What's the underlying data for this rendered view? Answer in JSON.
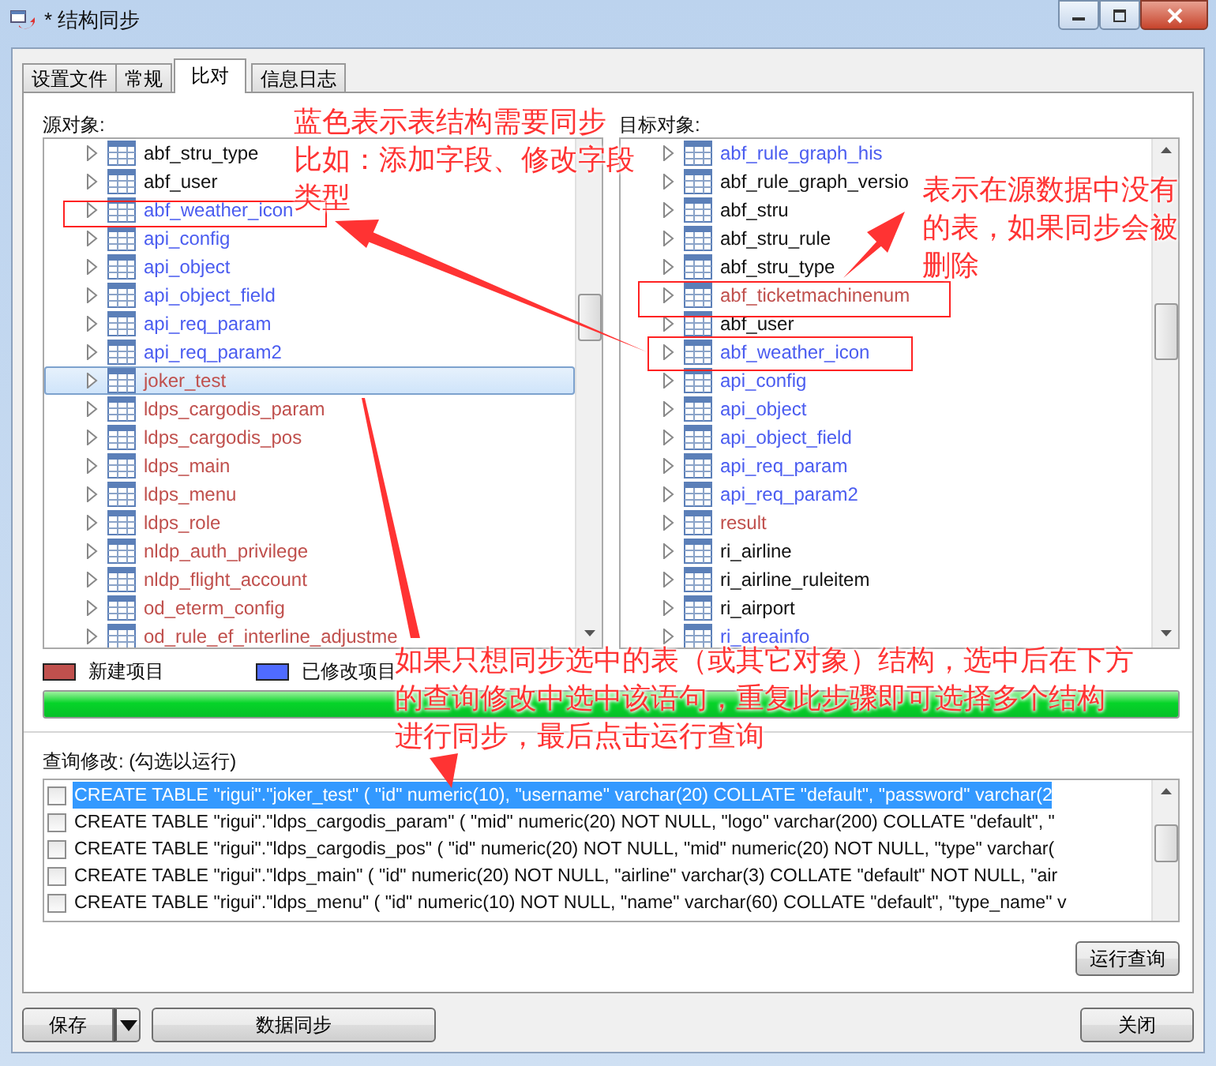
{
  "window": {
    "title": "* 结构同步"
  },
  "tabs": [
    {
      "label": "设置文件",
      "selected": false
    },
    {
      "label": "常规",
      "selected": false
    },
    {
      "label": "比对",
      "selected": true
    },
    {
      "label": "信息日志",
      "selected": false
    }
  ],
  "source": {
    "label": "源对象:",
    "items": [
      {
        "name": "abf_stru_type",
        "kind": "same",
        "selected": false
      },
      {
        "name": "abf_user",
        "kind": "same",
        "selected": false
      },
      {
        "name": "abf_weather_icon",
        "kind": "modified",
        "selected": false
      },
      {
        "name": "api_config",
        "kind": "modified",
        "selected": false
      },
      {
        "name": "api_object",
        "kind": "modified",
        "selected": false
      },
      {
        "name": "api_object_field",
        "kind": "modified",
        "selected": false
      },
      {
        "name": "api_req_param",
        "kind": "modified",
        "selected": false
      },
      {
        "name": "api_req_param2",
        "kind": "modified",
        "selected": false
      },
      {
        "name": "joker_test",
        "kind": "new",
        "selected": true
      },
      {
        "name": "ldps_cargodis_param",
        "kind": "new",
        "selected": false
      },
      {
        "name": "ldps_cargodis_pos",
        "kind": "new",
        "selected": false
      },
      {
        "name": "ldps_main",
        "kind": "new",
        "selected": false
      },
      {
        "name": "ldps_menu",
        "kind": "new",
        "selected": false
      },
      {
        "name": "ldps_role",
        "kind": "new",
        "selected": false
      },
      {
        "name": "nldp_auth_privilege",
        "kind": "new",
        "selected": false
      },
      {
        "name": "nldp_flight_account",
        "kind": "new",
        "selected": false
      },
      {
        "name": "od_eterm_config",
        "kind": "new",
        "selected": false
      },
      {
        "name": "od_rule_ef_interline_adjustme",
        "kind": "new",
        "selected": false
      }
    ]
  },
  "target": {
    "label": "目标对象:",
    "items": [
      {
        "name": "abf_rule_graph_his",
        "kind": "modified",
        "selected": false
      },
      {
        "name": "abf_rule_graph_versio",
        "kind": "same",
        "selected": false
      },
      {
        "name": "abf_stru",
        "kind": "same",
        "selected": false
      },
      {
        "name": "abf_stru_rule",
        "kind": "same",
        "selected": false
      },
      {
        "name": "abf_stru_type",
        "kind": "same",
        "selected": false
      },
      {
        "name": "abf_ticketmachinenum",
        "kind": "new",
        "selected": false
      },
      {
        "name": "abf_user",
        "kind": "same",
        "selected": false
      },
      {
        "name": "abf_weather_icon",
        "kind": "modified",
        "selected": false
      },
      {
        "name": "api_config",
        "kind": "modified",
        "selected": false
      },
      {
        "name": "api_object",
        "kind": "modified",
        "selected": false
      },
      {
        "name": "api_object_field",
        "kind": "modified",
        "selected": false
      },
      {
        "name": "api_req_param",
        "kind": "modified",
        "selected": false
      },
      {
        "name": "api_req_param2",
        "kind": "modified",
        "selected": false
      },
      {
        "name": "result",
        "kind": "new",
        "selected": false
      },
      {
        "name": "ri_airline",
        "kind": "same",
        "selected": false
      },
      {
        "name": "ri_airline_ruleitem",
        "kind": "same",
        "selected": false
      },
      {
        "name": "ri_airport",
        "kind": "same",
        "selected": false
      },
      {
        "name": "ri_areainfo",
        "kind": "modified",
        "selected": false
      }
    ]
  },
  "legend": [
    {
      "label": "新建项目",
      "color": "#c0504d"
    },
    {
      "label": "已修改项目",
      "color": "#4f6bff"
    }
  ],
  "progress": {
    "level": 1
  },
  "queries": {
    "label": "查询修改: (勾选以运行)",
    "rows": [
      {
        "text": "CREATE TABLE \"rigui\".\"joker_test\" ( \"id\" numeric(10), \"username\" varchar(20) COLLATE \"default\", \"password\" varchar(2",
        "checked": false,
        "selected": true
      },
      {
        "text": "CREATE TABLE \"rigui\".\"ldps_cargodis_param\" ( \"mid\" numeric(20) NOT NULL, \"logo\" varchar(200) COLLATE \"default\", \"",
        "checked": false,
        "selected": false
      },
      {
        "text": "CREATE TABLE \"rigui\".\"ldps_cargodis_pos\" ( \"id\" numeric(20) NOT NULL, \"mid\" numeric(20) NOT NULL, \"type\" varchar(",
        "checked": false,
        "selected": false
      },
      {
        "text": "CREATE TABLE \"rigui\".\"ldps_main\" ( \"id\" numeric(20) NOT NULL, \"airline\" varchar(3) COLLATE \"default\" NOT NULL, \"air",
        "checked": false,
        "selected": false
      },
      {
        "text": "CREATE TABLE \"rigui\".\"ldps_menu\" ( \"id\" numeric(10) NOT NULL, \"name\" varchar(60) COLLATE \"default\", \"type_name\" v",
        "checked": false,
        "selected": false
      }
    ]
  },
  "buttons": {
    "run": "运行查询",
    "save": "保存",
    "sync": "数据同步",
    "close": "关闭"
  },
  "annotations": [
    {
      "lines": [
        "蓝色表示表结构需要同步",
        "比如：添加字段、修改字段",
        "类型"
      ]
    },
    {
      "lines": [
        "表示在源数据中没有",
        "的表，如果同步会被",
        "删除"
      ]
    },
    {
      "lines": [
        "如果只想同步选中的表（或其它对象）结构，选中后在下方",
        "的查询修改中选中该语句，重复此步骤即可选择多个结构",
        "进行同步，最后点击运行查询"
      ]
    }
  ]
}
